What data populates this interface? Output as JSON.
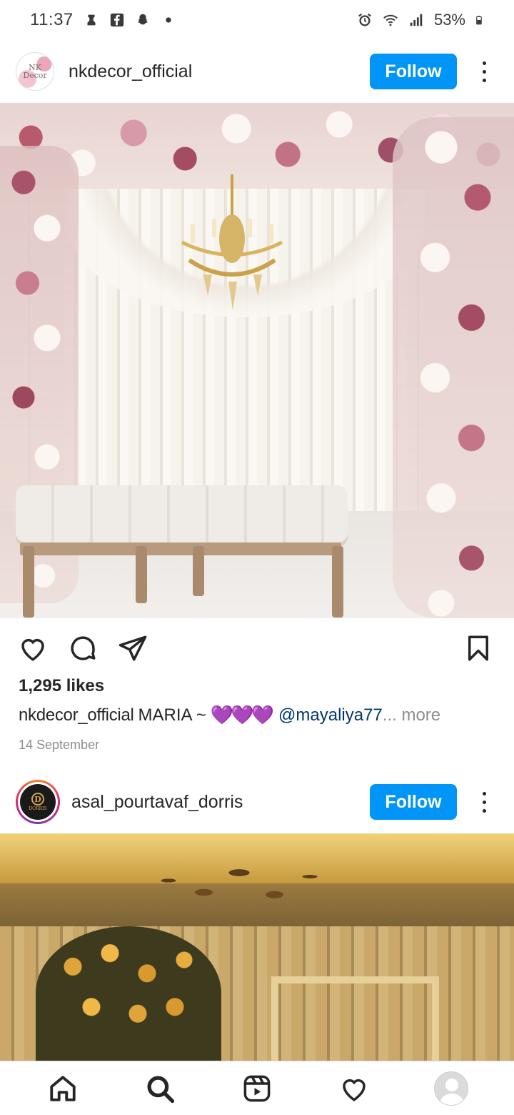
{
  "status_bar": {
    "time": "11:37",
    "battery": "53%",
    "left_icons": [
      "usb-debug-icon",
      "facebook-icon",
      "snapchat-icon",
      "notification-dot-icon"
    ],
    "right_icons": [
      "alarm-icon",
      "wifi-icon",
      "signal-icon",
      "battery-icon"
    ]
  },
  "posts": [
    {
      "username": "nkdecor_official",
      "avatar_text": "NK Decor",
      "follow_label": "Follow",
      "likes": "1,295 likes",
      "caption_user": "nkdecor_official",
      "caption_text": "MARIA ~",
      "caption_emoji": "💜💜💜",
      "caption_mention": "@mayaliya77",
      "caption_more": "... more",
      "date": "14 September"
    },
    {
      "username": "asal_pourtavaf_dorris",
      "avatar_text": "DORRIS",
      "avatar_letter": "D",
      "follow_label": "Follow"
    }
  ],
  "actions": [
    "like-icon",
    "comment-icon",
    "share-icon",
    "bookmark-icon"
  ],
  "bottom_nav": [
    "home-icon",
    "search-icon",
    "reels-icon",
    "activity-icon",
    "profile-avatar"
  ],
  "colors": {
    "follow_button": "#0095f6",
    "mention": "#00376b",
    "secondary_text": "#8e8e8e",
    "emoji_heart": "#a62ee8"
  }
}
